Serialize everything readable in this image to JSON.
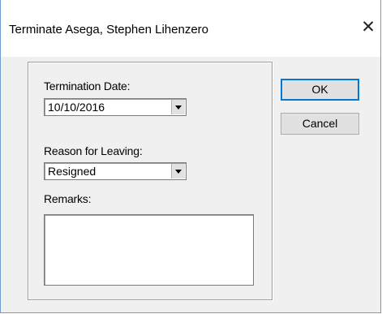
{
  "window": {
    "title": "Terminate Asega, Stephen Lihenzero"
  },
  "form": {
    "termination_date_label": "Termination Date:",
    "termination_date_value": "10/10/2016",
    "reason_label": "Reason for Leaving:",
    "reason_value": "Resigned",
    "remarks_label": "Remarks:",
    "remarks_value": ""
  },
  "buttons": {
    "ok_label": "OK",
    "cancel_label": "Cancel"
  },
  "icons": {
    "close": "close-icon",
    "dropdown": "chevron-down-icon"
  },
  "colors": {
    "window_bg": "#f0f0f0",
    "title_bg": "#ffffff",
    "default_button_border": "#0078d7"
  }
}
